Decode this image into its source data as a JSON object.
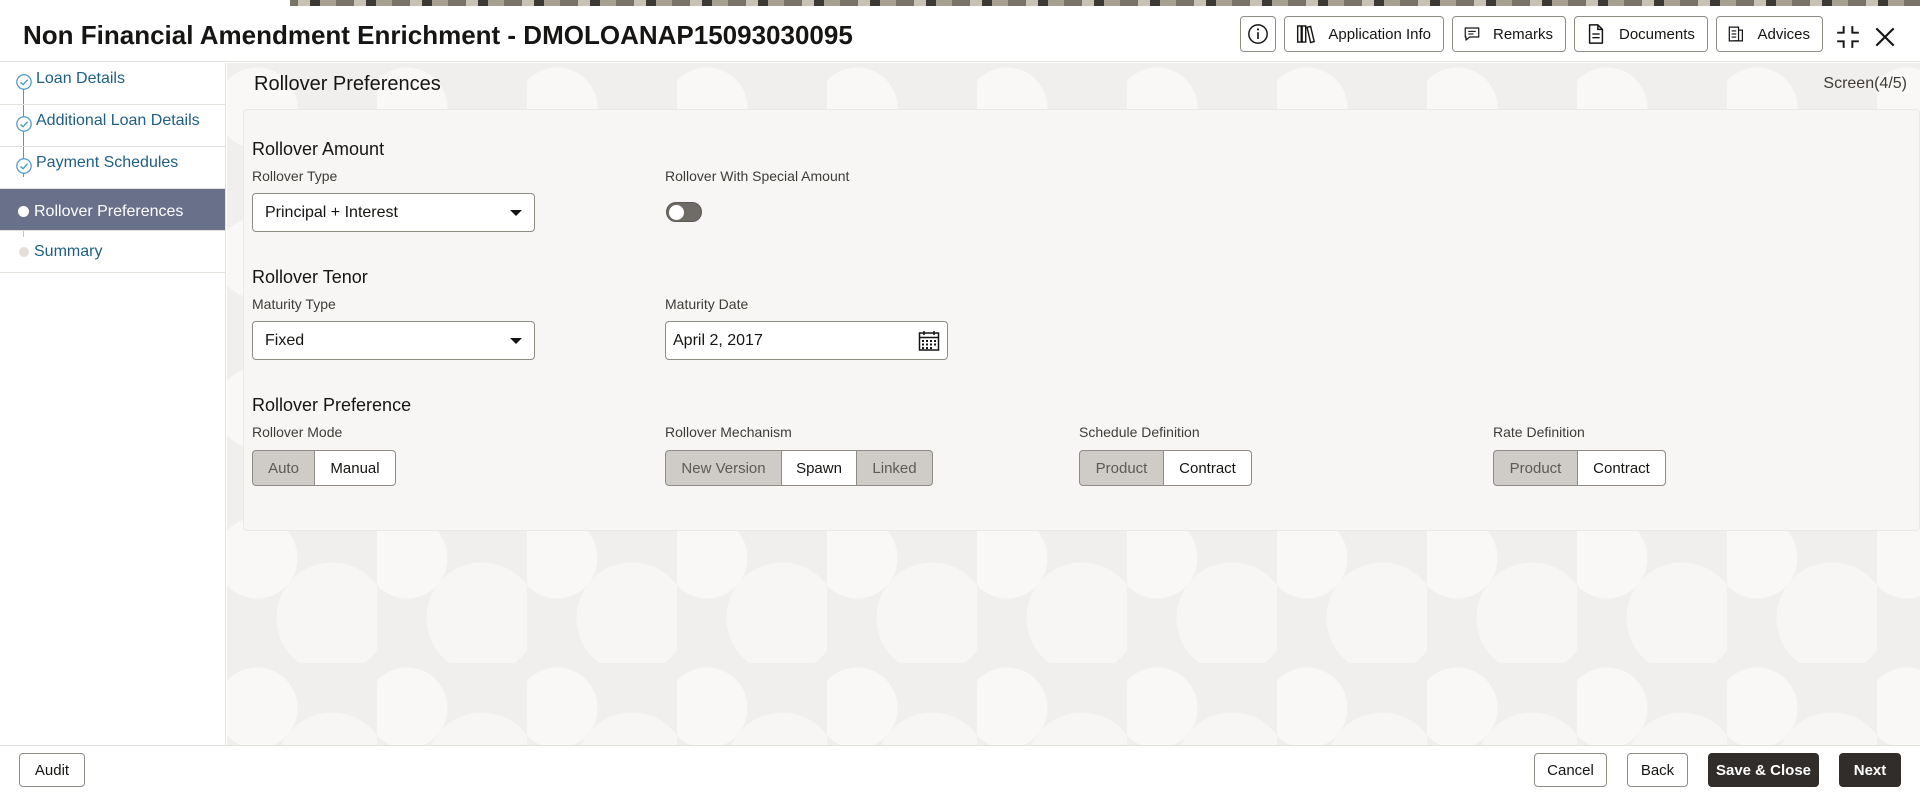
{
  "header": {
    "title": "Non Financial Amendment Enrichment - DMOLOANAP15093030095",
    "buttons": {
      "application_info": "Application Info",
      "remarks": "Remarks",
      "documents": "Documents",
      "advices": "Advices"
    }
  },
  "sidebar": {
    "items": [
      {
        "label": "Loan Details",
        "state": "completed"
      },
      {
        "label": "Additional Loan Details",
        "state": "completed"
      },
      {
        "label": "Payment Schedules",
        "state": "completed"
      },
      {
        "label": "Rollover Preferences",
        "state": "active"
      },
      {
        "label": "Summary",
        "state": "pending"
      }
    ]
  },
  "main": {
    "title": "Rollover Preferences",
    "screen_indicator": "Screen(4/5)",
    "rollover_amount": {
      "title": "Rollover Amount",
      "rollover_type_label": "Rollover Type",
      "rollover_type_value": "Principal + Interest",
      "special_amount_label": "Rollover With Special Amount",
      "special_amount_on": false
    },
    "rollover_tenor": {
      "title": "Rollover Tenor",
      "maturity_type_label": "Maturity Type",
      "maturity_type_value": "Fixed",
      "maturity_date_label": "Maturity Date",
      "maturity_date_value": "April 2, 2017"
    },
    "rollover_preference": {
      "title": "Rollover Preference",
      "mode": {
        "label": "Rollover Mode",
        "options": [
          "Auto",
          "Manual"
        ],
        "selected": [
          "Auto"
        ]
      },
      "mechanism": {
        "label": "Rollover Mechanism",
        "options": [
          "New Version",
          "Spawn",
          "Linked"
        ],
        "selected": [
          "New Version",
          "Linked"
        ]
      },
      "schedule_definition": {
        "label": "Schedule Definition",
        "options": [
          "Product",
          "Contract"
        ],
        "selected": [
          "Product"
        ]
      },
      "rate_definition": {
        "label": "Rate Definition",
        "options": [
          "Product",
          "Contract"
        ],
        "selected": [
          "Product"
        ]
      }
    }
  },
  "footer": {
    "audit": "Audit",
    "cancel": "Cancel",
    "back": "Back",
    "save_close": "Save & Close",
    "next": "Next"
  },
  "colors": {
    "primary_dark": "#312d2a",
    "sidebar_active": "#69708a",
    "link_blue": "#1f5f84",
    "progress_line": "#4d9bbf"
  }
}
